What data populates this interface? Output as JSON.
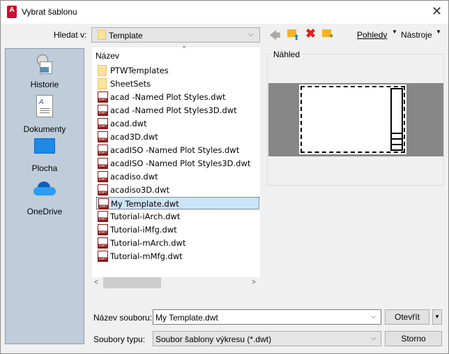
{
  "window": {
    "title": "Vybrat šablonu",
    "close": "✕",
    "app_icon": "A"
  },
  "toolbar": {
    "look_in_label": "Hledat v:",
    "look_in_value": "Template",
    "views": "Pohledy",
    "tools": "Nástroje"
  },
  "places": [
    {
      "label": "Historie",
      "icon": "history-icon"
    },
    {
      "label": "Dokumenty",
      "icon": "documents-icon"
    },
    {
      "label": "Plocha",
      "icon": "desktop-icon"
    },
    {
      "label": "OneDrive",
      "icon": "onedrive-icon"
    }
  ],
  "list": {
    "header": "Název",
    "items": [
      {
        "name": "PTWTemplates",
        "type": "folder"
      },
      {
        "name": "SheetSets",
        "type": "folder"
      },
      {
        "name": "acad -Named Plot Styles.dwt",
        "type": "dwt"
      },
      {
        "name": "acad -Named Plot Styles3D.dwt",
        "type": "dwt"
      },
      {
        "name": "acad.dwt",
        "type": "dwt"
      },
      {
        "name": "acad3D.dwt",
        "type": "dwt"
      },
      {
        "name": "acadISO -Named Plot Styles.dwt",
        "type": "dwt"
      },
      {
        "name": "acadISO -Named Plot Styles3D.dwt",
        "type": "dwt"
      },
      {
        "name": "acadiso.dwt",
        "type": "dwt"
      },
      {
        "name": "acadiso3D.dwt",
        "type": "dwt"
      },
      {
        "name": "My Template.dwt",
        "type": "dwt",
        "selected": true
      },
      {
        "name": "Tutorial-iArch.dwt",
        "type": "dwt"
      },
      {
        "name": "Tutorial-iMfg.dwt",
        "type": "dwt"
      },
      {
        "name": "Tutorial-mArch.dwt",
        "type": "dwt"
      },
      {
        "name": "Tutorial-mMfg.dwt",
        "type": "dwt"
      }
    ]
  },
  "preview": {
    "label": "Náhled"
  },
  "bottom": {
    "filename_label": "Název souboru:",
    "filename_value": "My Template.dwt",
    "filetype_label": "Soubory typu:",
    "filetype_value": "Soubor šablony výkresu (*.dwt)",
    "open": "Otevřít",
    "cancel": "Storno"
  }
}
